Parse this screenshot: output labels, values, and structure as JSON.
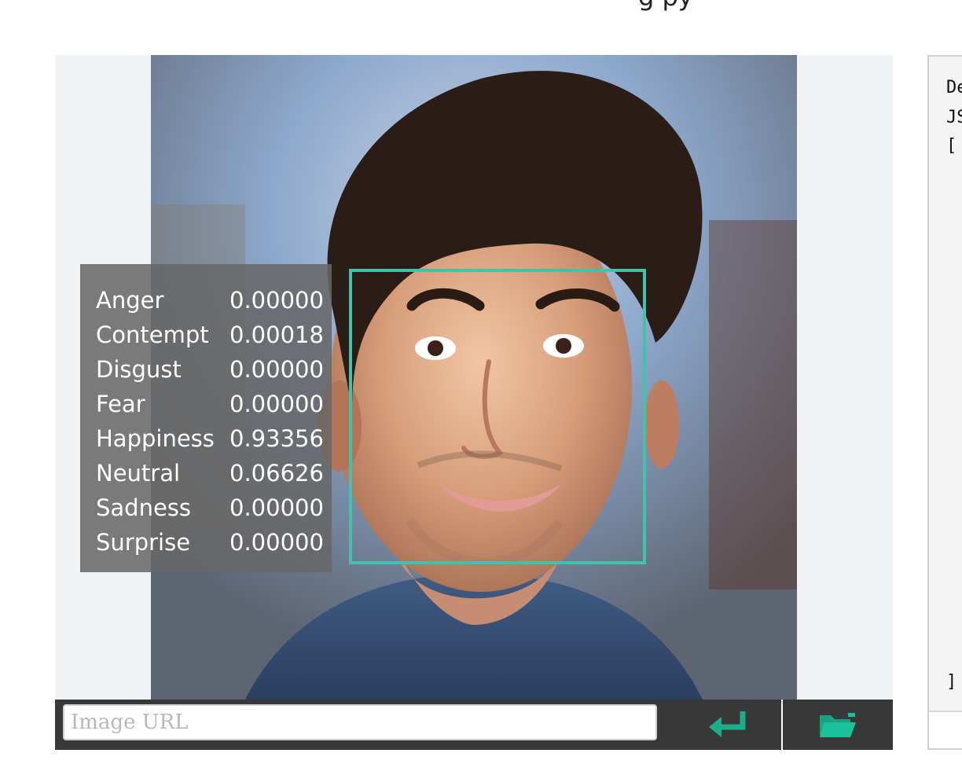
{
  "header": {
    "cutoff_text": "g                py"
  },
  "viewer": {
    "emotions": [
      {
        "label": "Anger",
        "value": "0.00000"
      },
      {
        "label": "Contempt",
        "value": "0.00018"
      },
      {
        "label": "Disgust",
        "value": "0.00000"
      },
      {
        "label": "Fear",
        "value": "0.00000"
      },
      {
        "label": "Happiness",
        "value": "0.93356"
      },
      {
        "label": "Neutral",
        "value": "0.06626"
      },
      {
        "label": "Sadness",
        "value": "0.00000"
      },
      {
        "label": "Surprise",
        "value": "0.00000"
      }
    ],
    "face_box_color": "#40c3aa"
  },
  "controls": {
    "url_placeholder": "Image URL",
    "submit_icon": "enter-icon",
    "folder_icon": "folder-open-icon",
    "accent_color": "#1cae89"
  },
  "json_panel": {
    "line1": "De",
    "line2": "JS",
    "line3": "[",
    "line4": "]"
  }
}
